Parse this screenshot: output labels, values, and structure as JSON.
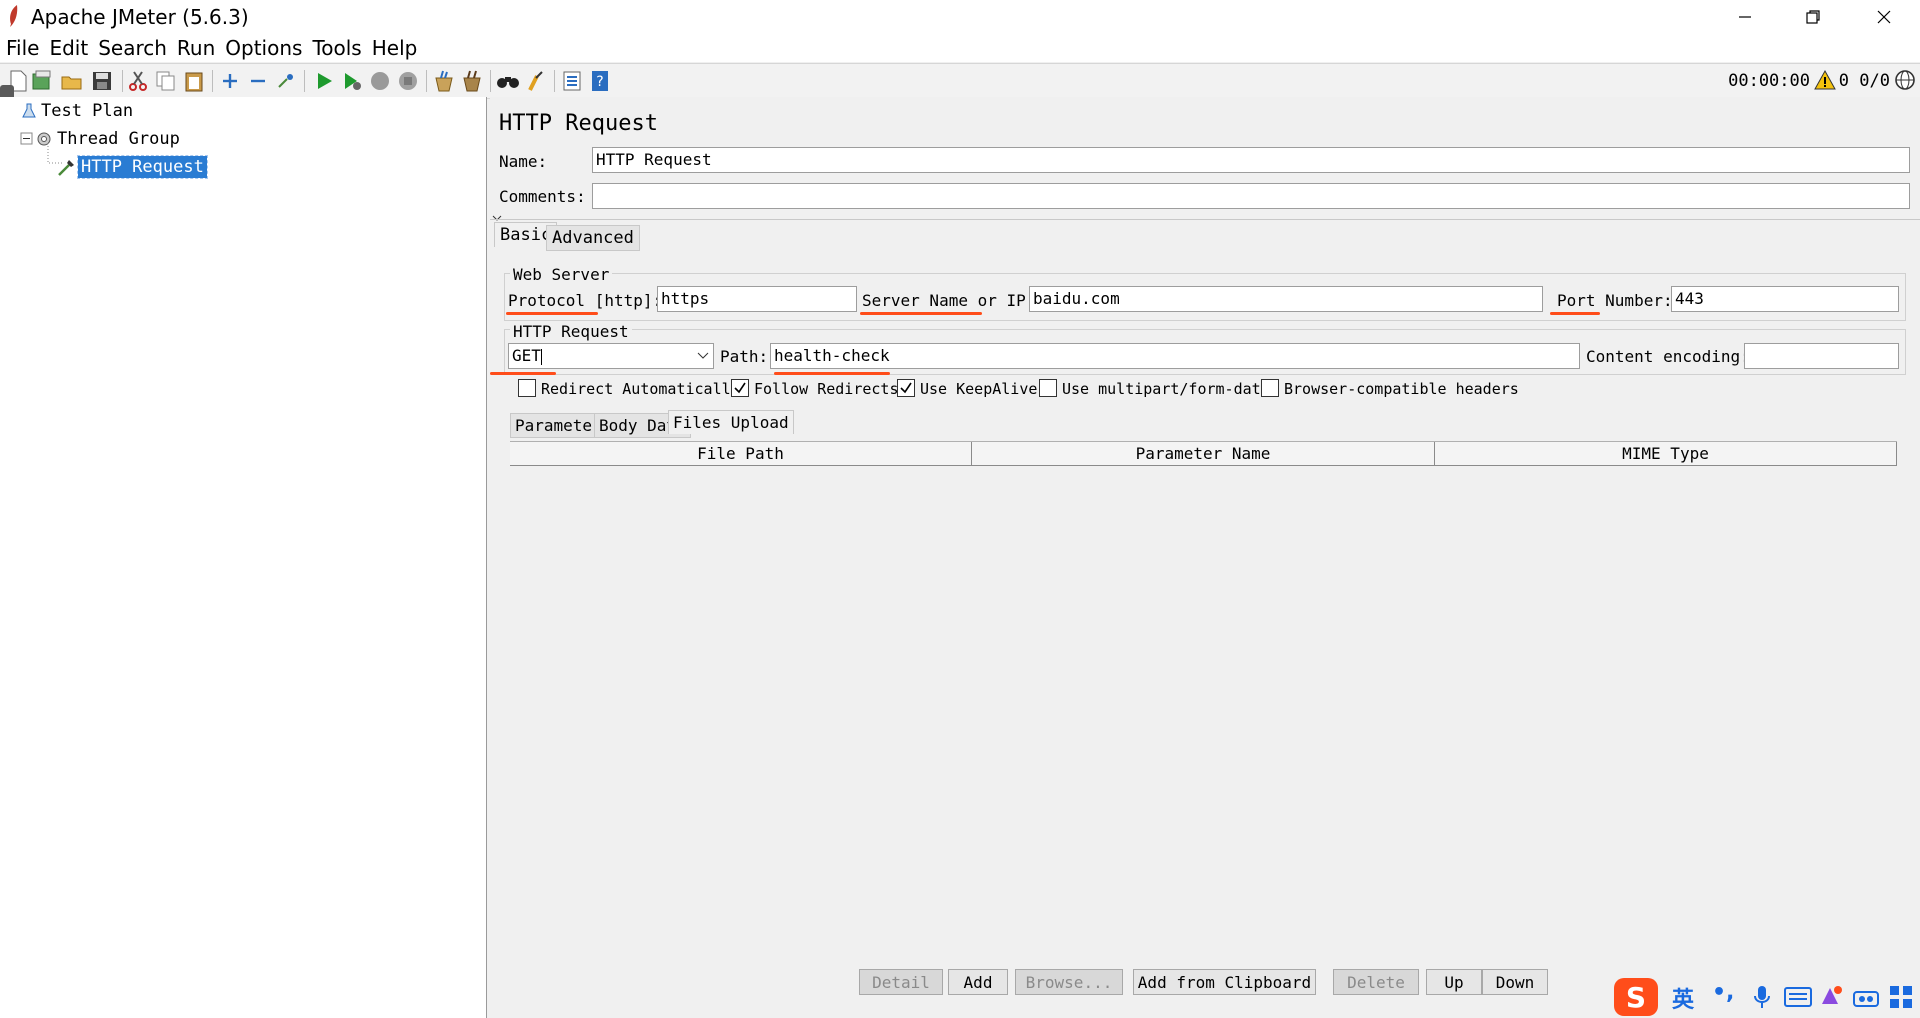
{
  "window": {
    "title": "Apache JMeter (5.6.3)"
  },
  "menu": [
    "File",
    "Edit",
    "Search",
    "Run",
    "Options",
    "Tools",
    "Help"
  ],
  "status": {
    "timer": "00:00:00",
    "warnings": "0",
    "threads": "0/0"
  },
  "tree": {
    "items": [
      {
        "label": "Test Plan"
      },
      {
        "label": "Thread Group"
      },
      {
        "label": "HTTP Request",
        "selected": true
      }
    ]
  },
  "panel": {
    "title": "HTTP Request",
    "name_label": "Name:",
    "name_value": "HTTP Request",
    "comments_label": "Comments:",
    "comments_value": "",
    "tabs": [
      "Basic",
      "Advanced"
    ],
    "web_server": {
      "legend": "Web Server",
      "protocol_label": "Protocol [http]:",
      "protocol_value": "https",
      "server_label": "Server Name or IP:",
      "server_value": "baidu.com",
      "port_label": "Port Number:",
      "port_value": "443"
    },
    "http_request": {
      "legend": "HTTP Request",
      "method": "GET",
      "path_label": "Path:",
      "path_value": "health-check",
      "encoding_label": "Content encoding:",
      "encoding_value": ""
    },
    "checkboxes": [
      {
        "label": "Redirect Automatically",
        "checked": false
      },
      {
        "label": "Follow Redirects",
        "checked": true
      },
      {
        "label": "Use KeepAlive",
        "checked": true
      },
      {
        "label": "Use multipart/form-data",
        "checked": false
      },
      {
        "label": "Browser-compatible headers",
        "checked": false
      }
    ],
    "subtabs": [
      "Parameters",
      "Body Data",
      "Files Upload"
    ],
    "table_headers": [
      "File Path",
      "Parameter Name",
      "MIME Type"
    ],
    "buttons": [
      {
        "label": "Detail",
        "enabled": false
      },
      {
        "label": "Add",
        "enabled": true
      },
      {
        "label": "Browse...",
        "enabled": false
      },
      {
        "label": "Add from Clipboard",
        "enabled": true
      },
      {
        "label": "Delete",
        "enabled": false
      },
      {
        "label": "Up",
        "enabled": true
      },
      {
        "label": "Down",
        "enabled": true
      }
    ]
  },
  "ime": {
    "lang": "英",
    "punct": "•,"
  },
  "colors": {
    "accent": "#2a7cd3",
    "annotation": "#ff4d1a"
  }
}
